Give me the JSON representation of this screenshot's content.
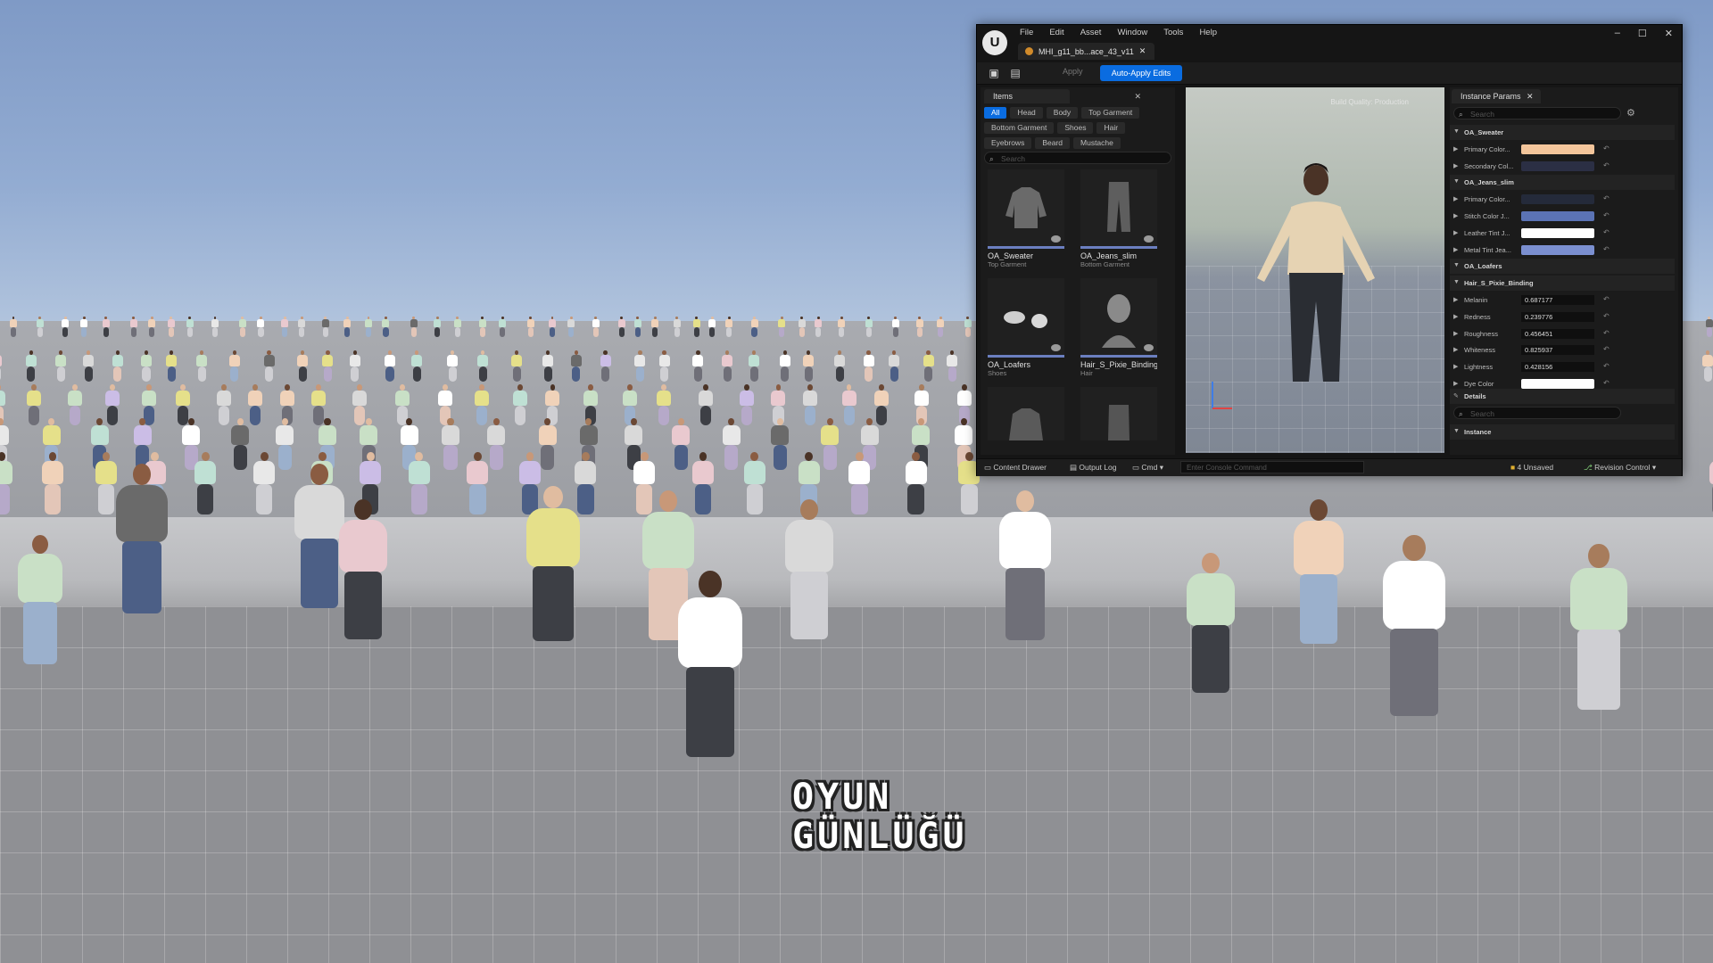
{
  "editor": {
    "logo": "U",
    "menu": [
      "File",
      "Edit",
      "Asset",
      "Window",
      "Tools",
      "Help"
    ],
    "doc_tab": "MHI_g11_bb...ace_43_v11",
    "window_controls": [
      "–",
      "☐",
      "✕"
    ],
    "toolbar": {
      "apply_label": "Apply",
      "auto_apply_label": "Auto-Apply Edits"
    },
    "items_panel": {
      "tab_label": "Items",
      "filters": [
        "All",
        "Head",
        "Body",
        "Top Garment",
        "Bottom Garment",
        "Shoes",
        "Hair",
        "Eyebrows",
        "Beard",
        "Mustache"
      ],
      "active_filter": "All",
      "search_placeholder": "Search",
      "items": [
        {
          "name": "OA_Sweater",
          "category": "Top Garment"
        },
        {
          "name": "OA_Jeans_slim",
          "category": "Bottom Garment"
        },
        {
          "name": "OA_Loafers",
          "category": "Shoes"
        },
        {
          "name": "Hair_S_Pixie_Binding",
          "category": "Hair"
        }
      ]
    },
    "viewport": {
      "label": "Build Quality: Production"
    },
    "params_panel": {
      "tab_label": "Instance Params",
      "search_placeholder": "Search",
      "rows": [
        {
          "type": "group",
          "label": "OA_Sweater"
        },
        {
          "type": "color",
          "label": "Primary Color...",
          "color": "#f3c59b"
        },
        {
          "type": "color",
          "label": "Secondary Col...",
          "color": "#2b2f44"
        },
        {
          "type": "group",
          "label": "OA_Jeans_slim"
        },
        {
          "type": "color",
          "label": "Primary Color...",
          "color": "#242a3a"
        },
        {
          "type": "color",
          "label": "Stitch Color J...",
          "color": "#5b73b5"
        },
        {
          "type": "color",
          "label": "Leather Tint J...",
          "color": "#ffffff"
        },
        {
          "type": "color",
          "label": "Metal Tint Jea...",
          "color": "#7b8fd0"
        },
        {
          "type": "group",
          "label": "OA_Loafers"
        },
        {
          "type": "group",
          "label": "Hair_S_Pixie_Binding"
        },
        {
          "type": "number",
          "label": "Melanin",
          "value": "0.687177"
        },
        {
          "type": "number",
          "label": "Redness",
          "value": "0.239776"
        },
        {
          "type": "number",
          "label": "Roughness",
          "value": "0.456451"
        },
        {
          "type": "number",
          "label": "Whiteness",
          "value": "0.825937"
        },
        {
          "type": "number",
          "label": "Lightness",
          "value": "0.428156"
        },
        {
          "type": "color",
          "label": "Dye Color",
          "color": "#ffffff"
        }
      ],
      "details_label": "Details",
      "details_search_placeholder": "Search",
      "instance_label": "Instance"
    },
    "statusbar": {
      "content_drawer": "Content Drawer",
      "output_log": "Output Log",
      "cmd": "Cmd",
      "console_placeholder": "Enter Console Command",
      "unsaved": "4 Unsaved",
      "revision_control": "Revision Control"
    }
  },
  "watermark": {
    "line1": "OYUN",
    "line2": "GÜNLÜĞÜ"
  },
  "colors": {
    "accent": "#0a6ce0"
  }
}
